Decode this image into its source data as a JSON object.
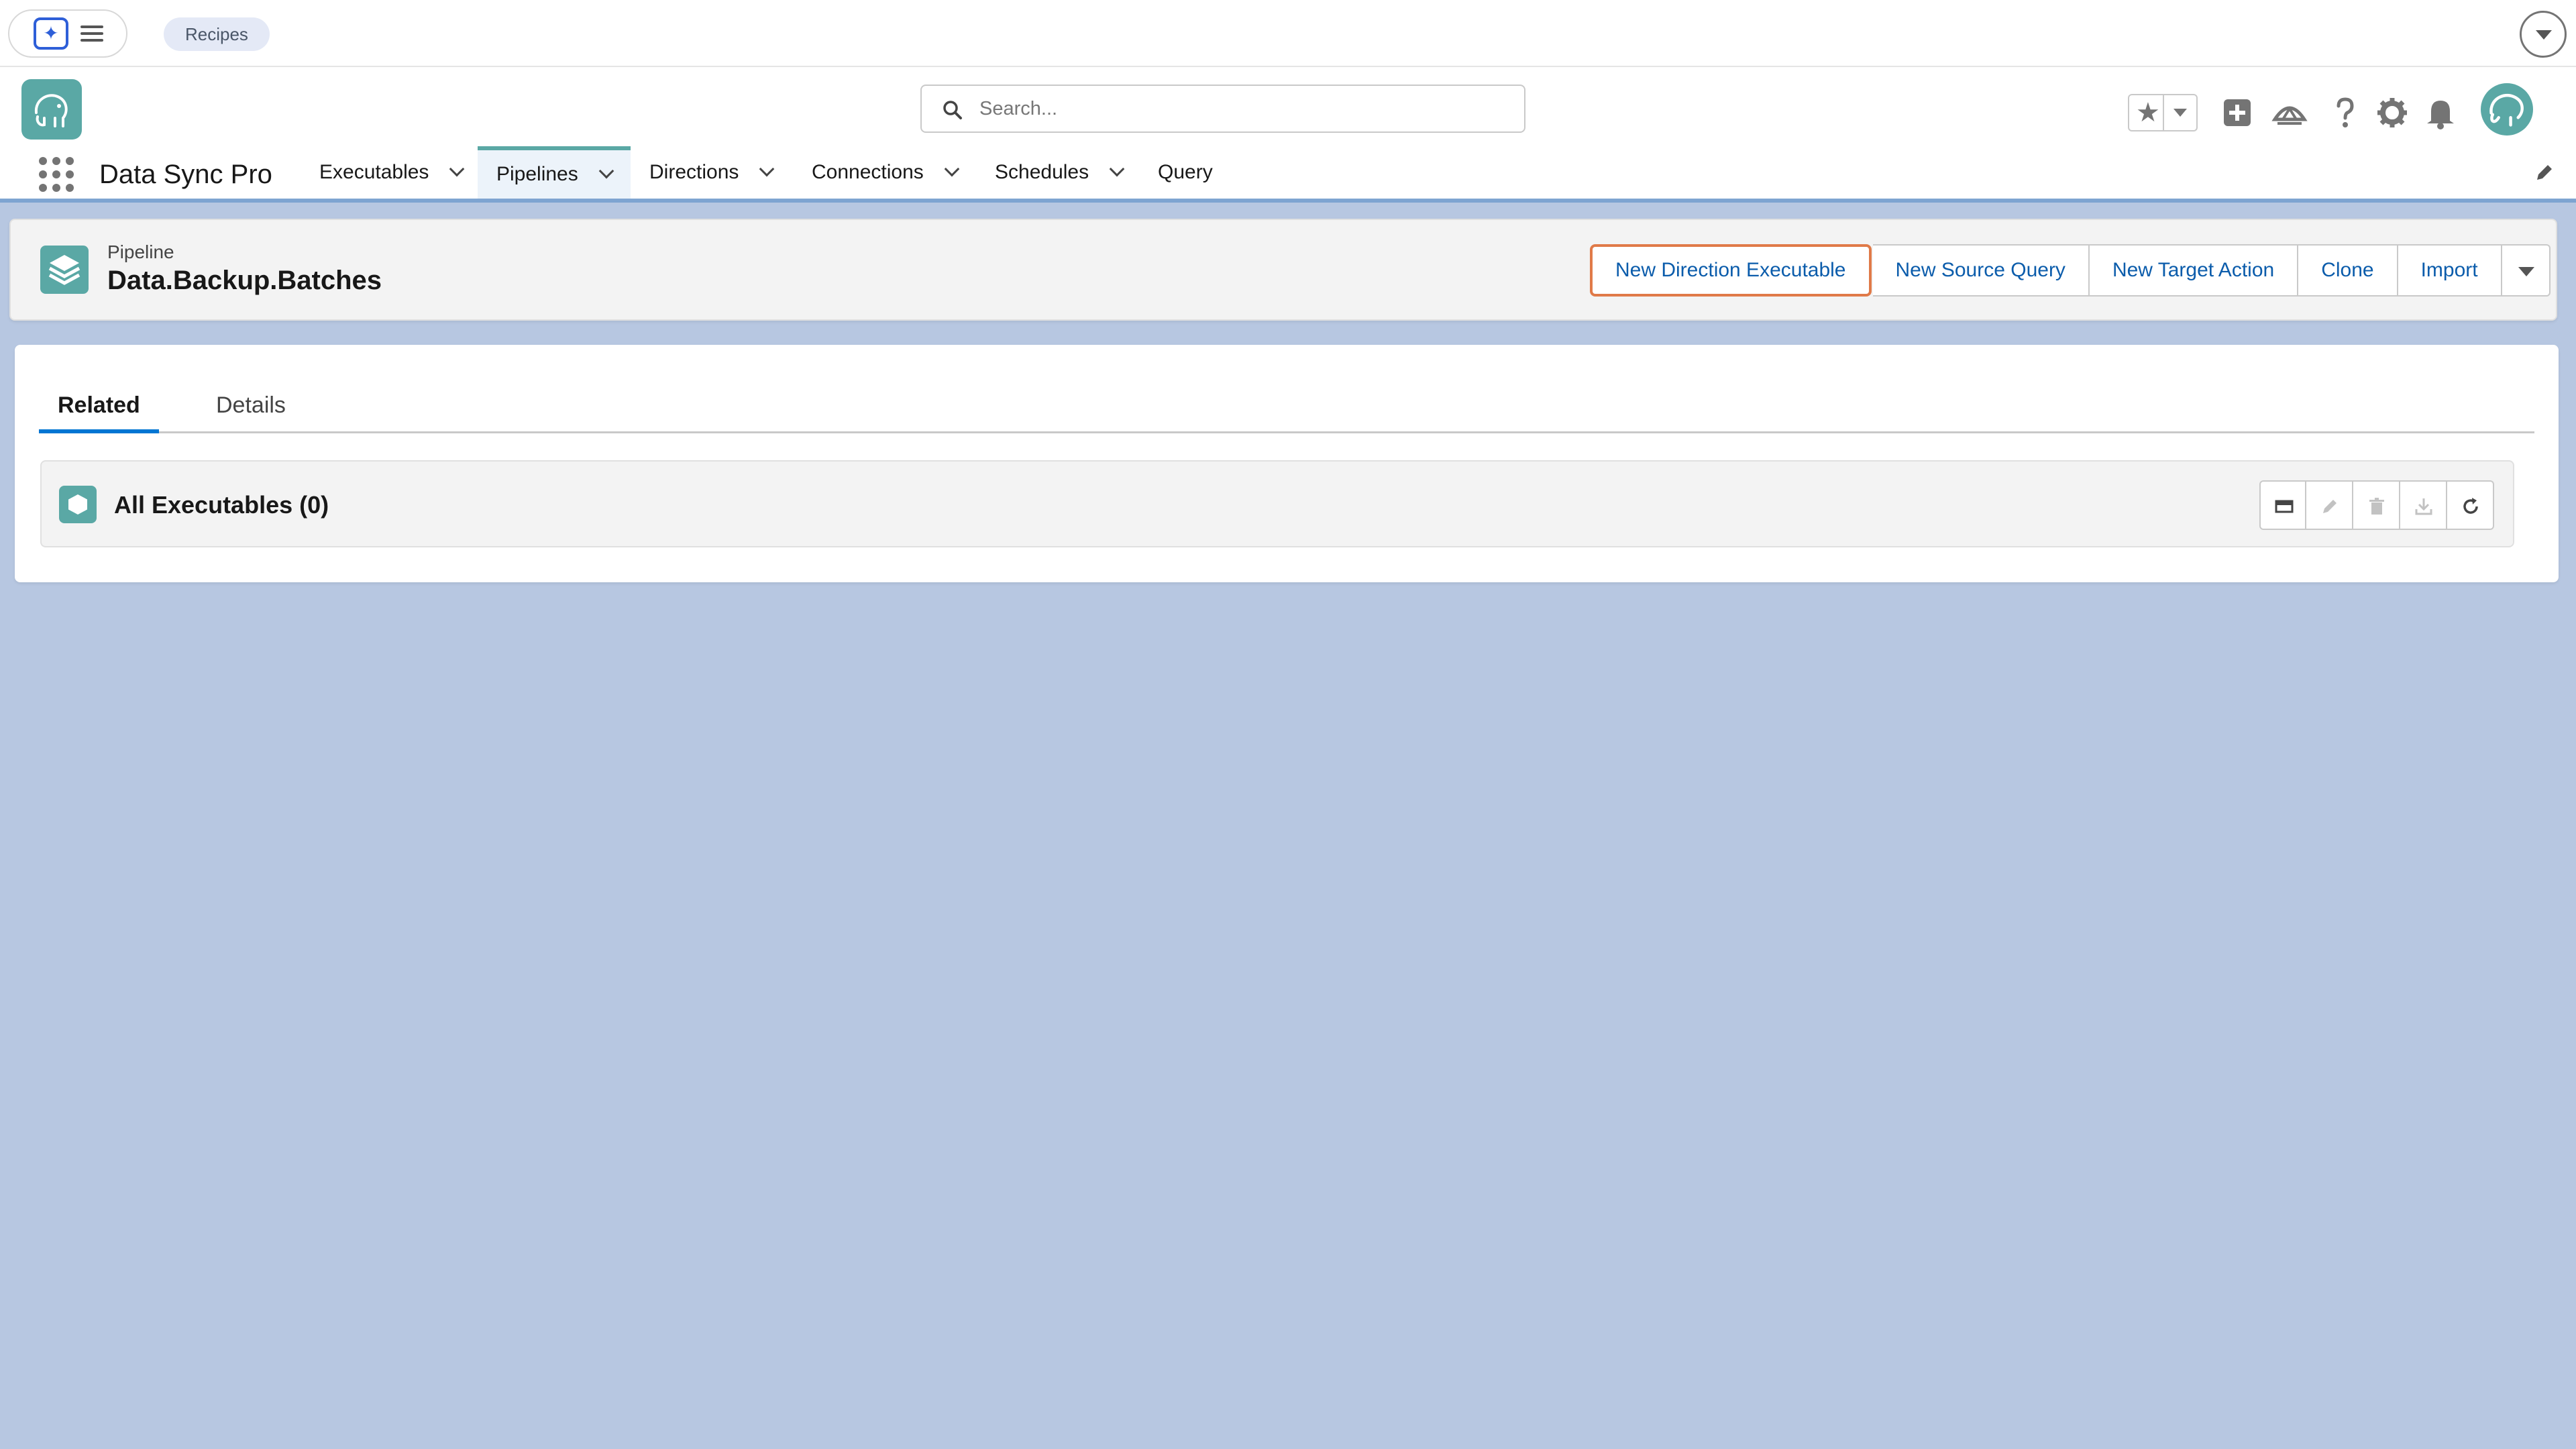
{
  "system_bar": {
    "recipes_label": "Recipes"
  },
  "header": {
    "search_placeholder": "Search..."
  },
  "app_nav": {
    "app_name": "Data Sync Pro",
    "items": [
      {
        "label": "Executables",
        "has_menu": true
      },
      {
        "label": "Pipelines",
        "has_menu": true,
        "active": true
      },
      {
        "label": "Directions",
        "has_menu": true
      },
      {
        "label": "Connections",
        "has_menu": true
      },
      {
        "label": "Schedules",
        "has_menu": true
      },
      {
        "label": "Query",
        "has_menu": false
      }
    ]
  },
  "record": {
    "object_type": "Pipeline",
    "name": "Data.Backup.Batches",
    "actions": [
      "New Direction Executable",
      "New Source Query",
      "New Target Action",
      "Clone",
      "Import"
    ]
  },
  "tabs": [
    "Related",
    "Details"
  ],
  "related_list": {
    "title": "All Executables (0)"
  },
  "colors": {
    "brand_teal": "#5aa8a5",
    "link_blue": "#0b5cab",
    "tab_active": "#0176d3",
    "focus_ring": "#e07a48",
    "page_background": "#b7c7e1"
  }
}
